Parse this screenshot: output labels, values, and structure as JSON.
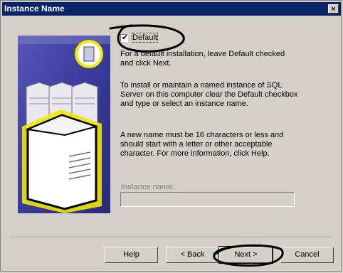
{
  "window": {
    "title": "Instance Name",
    "close_glyph": "×"
  },
  "checkbox": {
    "label": "Default",
    "checked": true,
    "mark": "✔"
  },
  "paragraphs": [
    "For a default installation, leave Default checked and click Next.",
    "To install or maintain a named instance of SQL Server on this computer clear the Default checkbox and type or select an instance name.",
    "A new name must be 16 characters or less and should start with a letter or other acceptable character. For more information, click Help."
  ],
  "instance": {
    "label": "Instance name:",
    "value": ""
  },
  "buttons": {
    "help": "Help",
    "back": "< Back",
    "next": "Next >",
    "cancel": "Cancel"
  },
  "colors": {
    "titlebar": "#0a246a",
    "panel_blue": "#3a3a9a",
    "highlight_yellow": "#f0e800"
  }
}
